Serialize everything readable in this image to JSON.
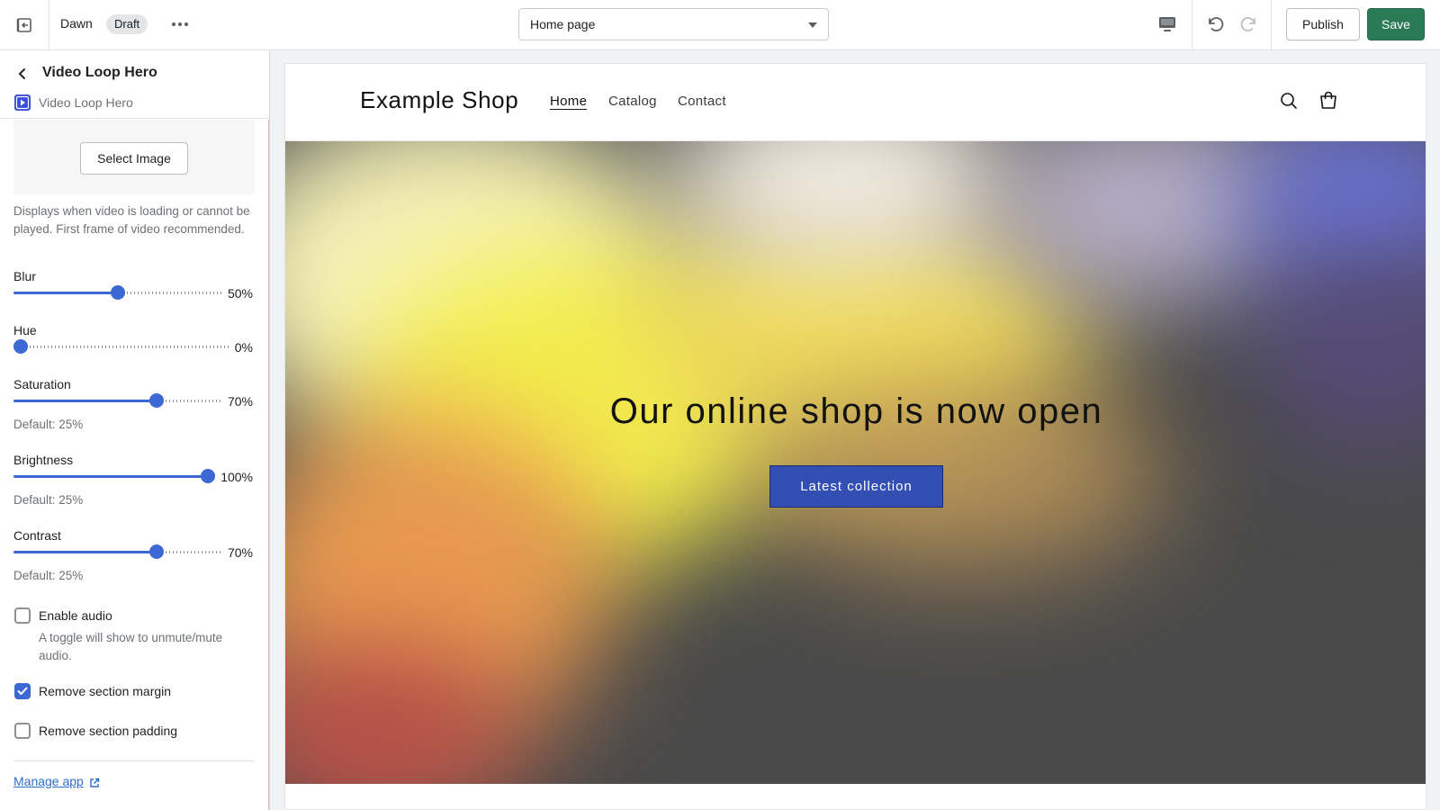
{
  "topbar": {
    "theme_name": "Dawn",
    "status_badge": "Draft",
    "page_selector": "Home page",
    "publish_label": "Publish",
    "save_label": "Save"
  },
  "sidebar": {
    "title": "Video Loop Hero",
    "app_name": "Video Loop Hero",
    "select_image_label": "Select Image",
    "image_help": "Displays when video is loading or cannot be played. First frame of video recommended.",
    "sliders": [
      {
        "label": "Blur",
        "value": 50,
        "display": "50%",
        "default_text": ""
      },
      {
        "label": "Hue",
        "value": 0,
        "display": "0%",
        "default_text": ""
      },
      {
        "label": "Saturation",
        "value": 70,
        "display": "70%",
        "default_text": "Default: 25%"
      },
      {
        "label": "Brightness",
        "value": 100,
        "display": "100%",
        "default_text": "Default: 25%"
      },
      {
        "label": "Contrast",
        "value": 70,
        "display": "70%",
        "default_text": "Default: 25%"
      }
    ],
    "checkboxes": [
      {
        "label": "Enable audio",
        "checked": false,
        "help": "A toggle will show to unmute/mute audio."
      },
      {
        "label": "Remove section margin",
        "checked": true,
        "help": ""
      },
      {
        "label": "Remove section padding",
        "checked": false,
        "help": ""
      }
    ],
    "manage_app_label": "Manage app"
  },
  "preview": {
    "shop_name": "Example Shop",
    "nav": [
      "Home",
      "Catalog",
      "Contact"
    ],
    "active_nav": "Home",
    "hero_heading": "Our online shop is now open",
    "hero_button": "Latest collection"
  },
  "colors": {
    "accent": "#3b68d3",
    "save_green": "#2b7a56",
    "hero_button": "#334fb4",
    "link": "#2c6ecb"
  }
}
